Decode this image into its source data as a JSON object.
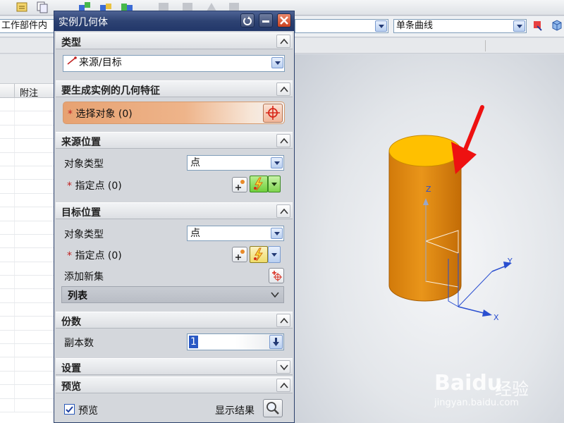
{
  "toolbar": {
    "scope_value": "工作部件内",
    "filter_value": "",
    "curve_rule_value": "单条曲线"
  },
  "left_table": {
    "column_header": "附注"
  },
  "dialog": {
    "title": "实例几何体",
    "type_section": {
      "title": "类型",
      "type_value": "来源/目标"
    },
    "geometry_section": {
      "title": "要生成实例的几何特征",
      "select_label": "选择对象 (0)",
      "required_mark": "*"
    },
    "source_section": {
      "title": "来源位置",
      "object_type_label": "对象类型",
      "object_type_value": "点",
      "point_label": "指定点 (0)",
      "required_mark": "*"
    },
    "target_section": {
      "title": "目标位置",
      "object_type_label": "对象类型",
      "object_type_value": "点",
      "point_label": "指定点 (0)",
      "required_mark": "*",
      "add_set_label": "添加新集",
      "list_label": "列表"
    },
    "copies_section": {
      "title": "份数",
      "copies_label": "副本数",
      "copies_value": "1"
    },
    "settings_section": {
      "title": "设置"
    },
    "preview_section": {
      "title": "预览",
      "preview_label": "预览",
      "preview_checked": true,
      "show_result_label": "显示结果"
    }
  },
  "viewport": {
    "axis_labels": {
      "z": "Z",
      "y": "Y",
      "x": "X"
    },
    "cylinder_color": "#e38a12",
    "cylinder_top_color": "#ffc000",
    "arrow_color": "#ee1111"
  },
  "watermark": {
    "brand": "Baidu",
    "brand_cn": "经验",
    "url": "jingyan.baidu.com"
  }
}
